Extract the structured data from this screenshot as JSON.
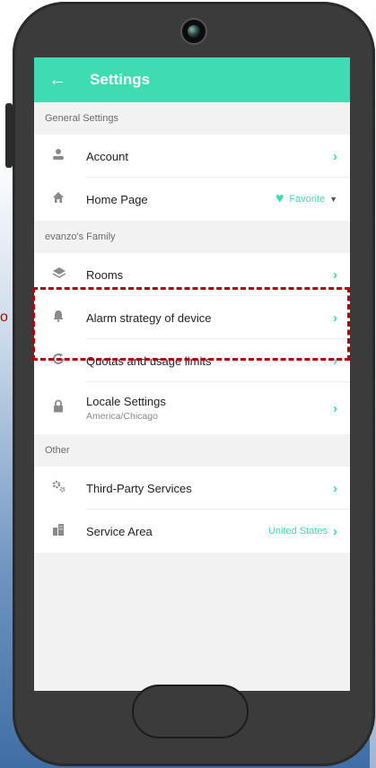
{
  "left_fragment": "o",
  "appbar": {
    "back_icon": "arrow-left-icon",
    "title": "Settings"
  },
  "sections": {
    "general": {
      "header": "General Settings"
    },
    "family": {
      "header": "evanzo's Family"
    },
    "other": {
      "header": "Other"
    }
  },
  "rows": {
    "account": {
      "label": "Account",
      "icon": "user-icon"
    },
    "home_page": {
      "label": "Home Page",
      "value": "Favorite",
      "icon": "home-icon"
    },
    "rooms": {
      "label": "Rooms",
      "icon": "layers-icon"
    },
    "alarm": {
      "label": "Alarm strategy of device",
      "icon": "bell-icon"
    },
    "quotas": {
      "label": "Quotas and usage limits",
      "icon": "refresh-icon"
    },
    "locale": {
      "label": "Locale Settings",
      "sub": "America/Chicago",
      "icon": "lock-icon"
    },
    "third_party": {
      "label": "Third-Party Services",
      "icon": "gears-icon"
    },
    "service_area": {
      "label": "Service Area",
      "value": "United States",
      "icon": "building-icon"
    }
  },
  "colors": {
    "accent": "#3fdbb2",
    "highlight": "#b30000",
    "frame": "#3b3b3b"
  }
}
